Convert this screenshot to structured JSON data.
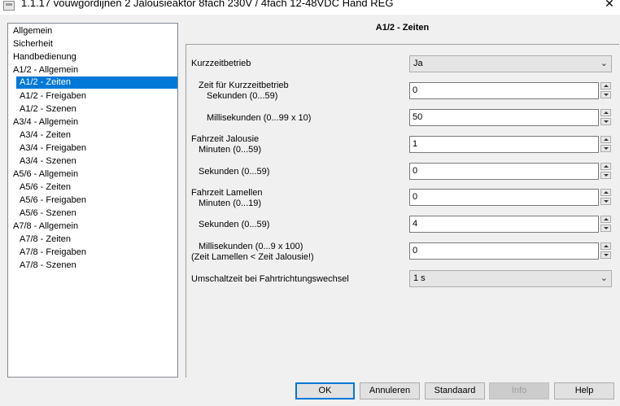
{
  "window": {
    "title": "1.1.17 vouwgordijnen 2 Jalousieaktor 8fach 230V / 4fach 12-48VDC Hand REG",
    "close_glyph": "✕"
  },
  "tree": {
    "items": [
      {
        "label": "Allgemein"
      },
      {
        "label": "Sicherheit"
      },
      {
        "label": "Handbedienung"
      },
      {
        "label": "A1/2 - Allgemein"
      },
      {
        "label": "A1/2 - Zeiten",
        "selected": true
      },
      {
        "label": "A1/2 - Freigaben"
      },
      {
        "label": "A1/2 - Szenen"
      },
      {
        "label": "A3/4 - Allgemein"
      },
      {
        "label": "A3/4 - Zeiten"
      },
      {
        "label": "A3/4 - Freigaben"
      },
      {
        "label": "A3/4 - Szenen"
      },
      {
        "label": "A5/6 - Allgemein"
      },
      {
        "label": "A5/6 - Zeiten"
      },
      {
        "label": "A5/6 - Freigaben"
      },
      {
        "label": "A5/6 - Szenen"
      },
      {
        "label": "A7/8 - Allgemein"
      },
      {
        "label": "A7/8 - Zeiten"
      },
      {
        "label": "A7/8 - Freigaben"
      },
      {
        "label": "A7/8 - Szenen"
      }
    ]
  },
  "panel": {
    "title": "A1/2 - Zeiten",
    "params": {
      "kurzzeitbetrieb": {
        "label": "Kurzzeitbetrieb",
        "value": "Ja"
      },
      "zeit_kurzzeit": {
        "label_line1": "Zeit für Kurzzeitbetrieb",
        "label_line2": "Sekunden (0...59)",
        "value": "0"
      },
      "millisekunden_kurzzeit": {
        "label": "Millisekunden (0...99 x 10)",
        "value": "50"
      },
      "fahrzeit_jalousie_min": {
        "label_line1": "Fahrzeit Jalousie",
        "label_line2": "Minuten (0...59)",
        "value": "1"
      },
      "fahrzeit_jalousie_sek": {
        "label": "Sekunden (0...59)",
        "value": "0"
      },
      "fahrzeit_lamellen_min": {
        "label_line1": "Fahrzeit Lamellen",
        "label_line2": "Minuten (0...19)",
        "value": "0"
      },
      "fahrzeit_lamellen_sek": {
        "label": "Sekunden (0...59)",
        "value": "4"
      },
      "millisekunden_lamellen": {
        "label_line1": "Millisekunden (0...9 x 100)",
        "label_line2": "(Zeit Lamellen < Zeit Jalousie!)",
        "value": "0"
      },
      "umschaltzeit": {
        "label": "Umschaltzeit bei Fahrtrichtungswechsel",
        "value": "1 s"
      }
    }
  },
  "buttons": {
    "ok": "OK",
    "cancel": "Annuleren",
    "default": "Standaard",
    "info": "Info",
    "help": "Help"
  },
  "icons": {
    "dropdown": "chevron-down-icon",
    "spin_up": "spin-up-icon",
    "spin_down": "spin-down-icon"
  },
  "colors": {
    "selection": "#0078d7"
  }
}
